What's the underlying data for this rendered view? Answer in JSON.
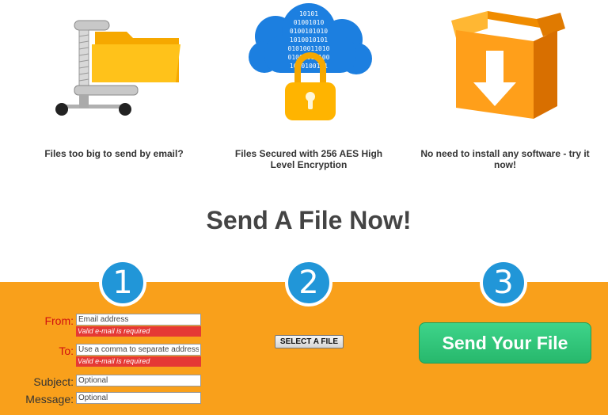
{
  "features": [
    {
      "icon": "file-compress-icon",
      "caption": "Files too big to send by email?"
    },
    {
      "icon": "cloud-lock-icon",
      "caption": "Files Secured with 256 AES High Level Encryption",
      "binary_text": [
        "10101",
        "01001010",
        "0100101010",
        "1010010101",
        "01010011010",
        "01001010100",
        "1010100101"
      ]
    },
    {
      "icon": "download-box-icon",
      "caption": "No need to install any software - try it now!"
    }
  ],
  "headline": "Send A File Now!",
  "steps": [
    "1",
    "2",
    "3"
  ],
  "form": {
    "from": {
      "label": "From:",
      "placeholder": "Email address",
      "error": "Valid e-mail is required"
    },
    "to": {
      "label": "To:",
      "placeholder": "Use a comma to separate addresses",
      "error": "Valid e-mail is required"
    },
    "subject": {
      "label": "Subject:",
      "placeholder": "Optional"
    },
    "message": {
      "label": "Message:",
      "placeholder": "Optional"
    }
  },
  "select_file_label": "SELECT A FILE",
  "send_label": "Send Your File",
  "colors": {
    "band": "#f9a01b",
    "step": "#2196d8",
    "send": "#2ec27a",
    "error": "#e53935",
    "required_label": "#d01010"
  }
}
